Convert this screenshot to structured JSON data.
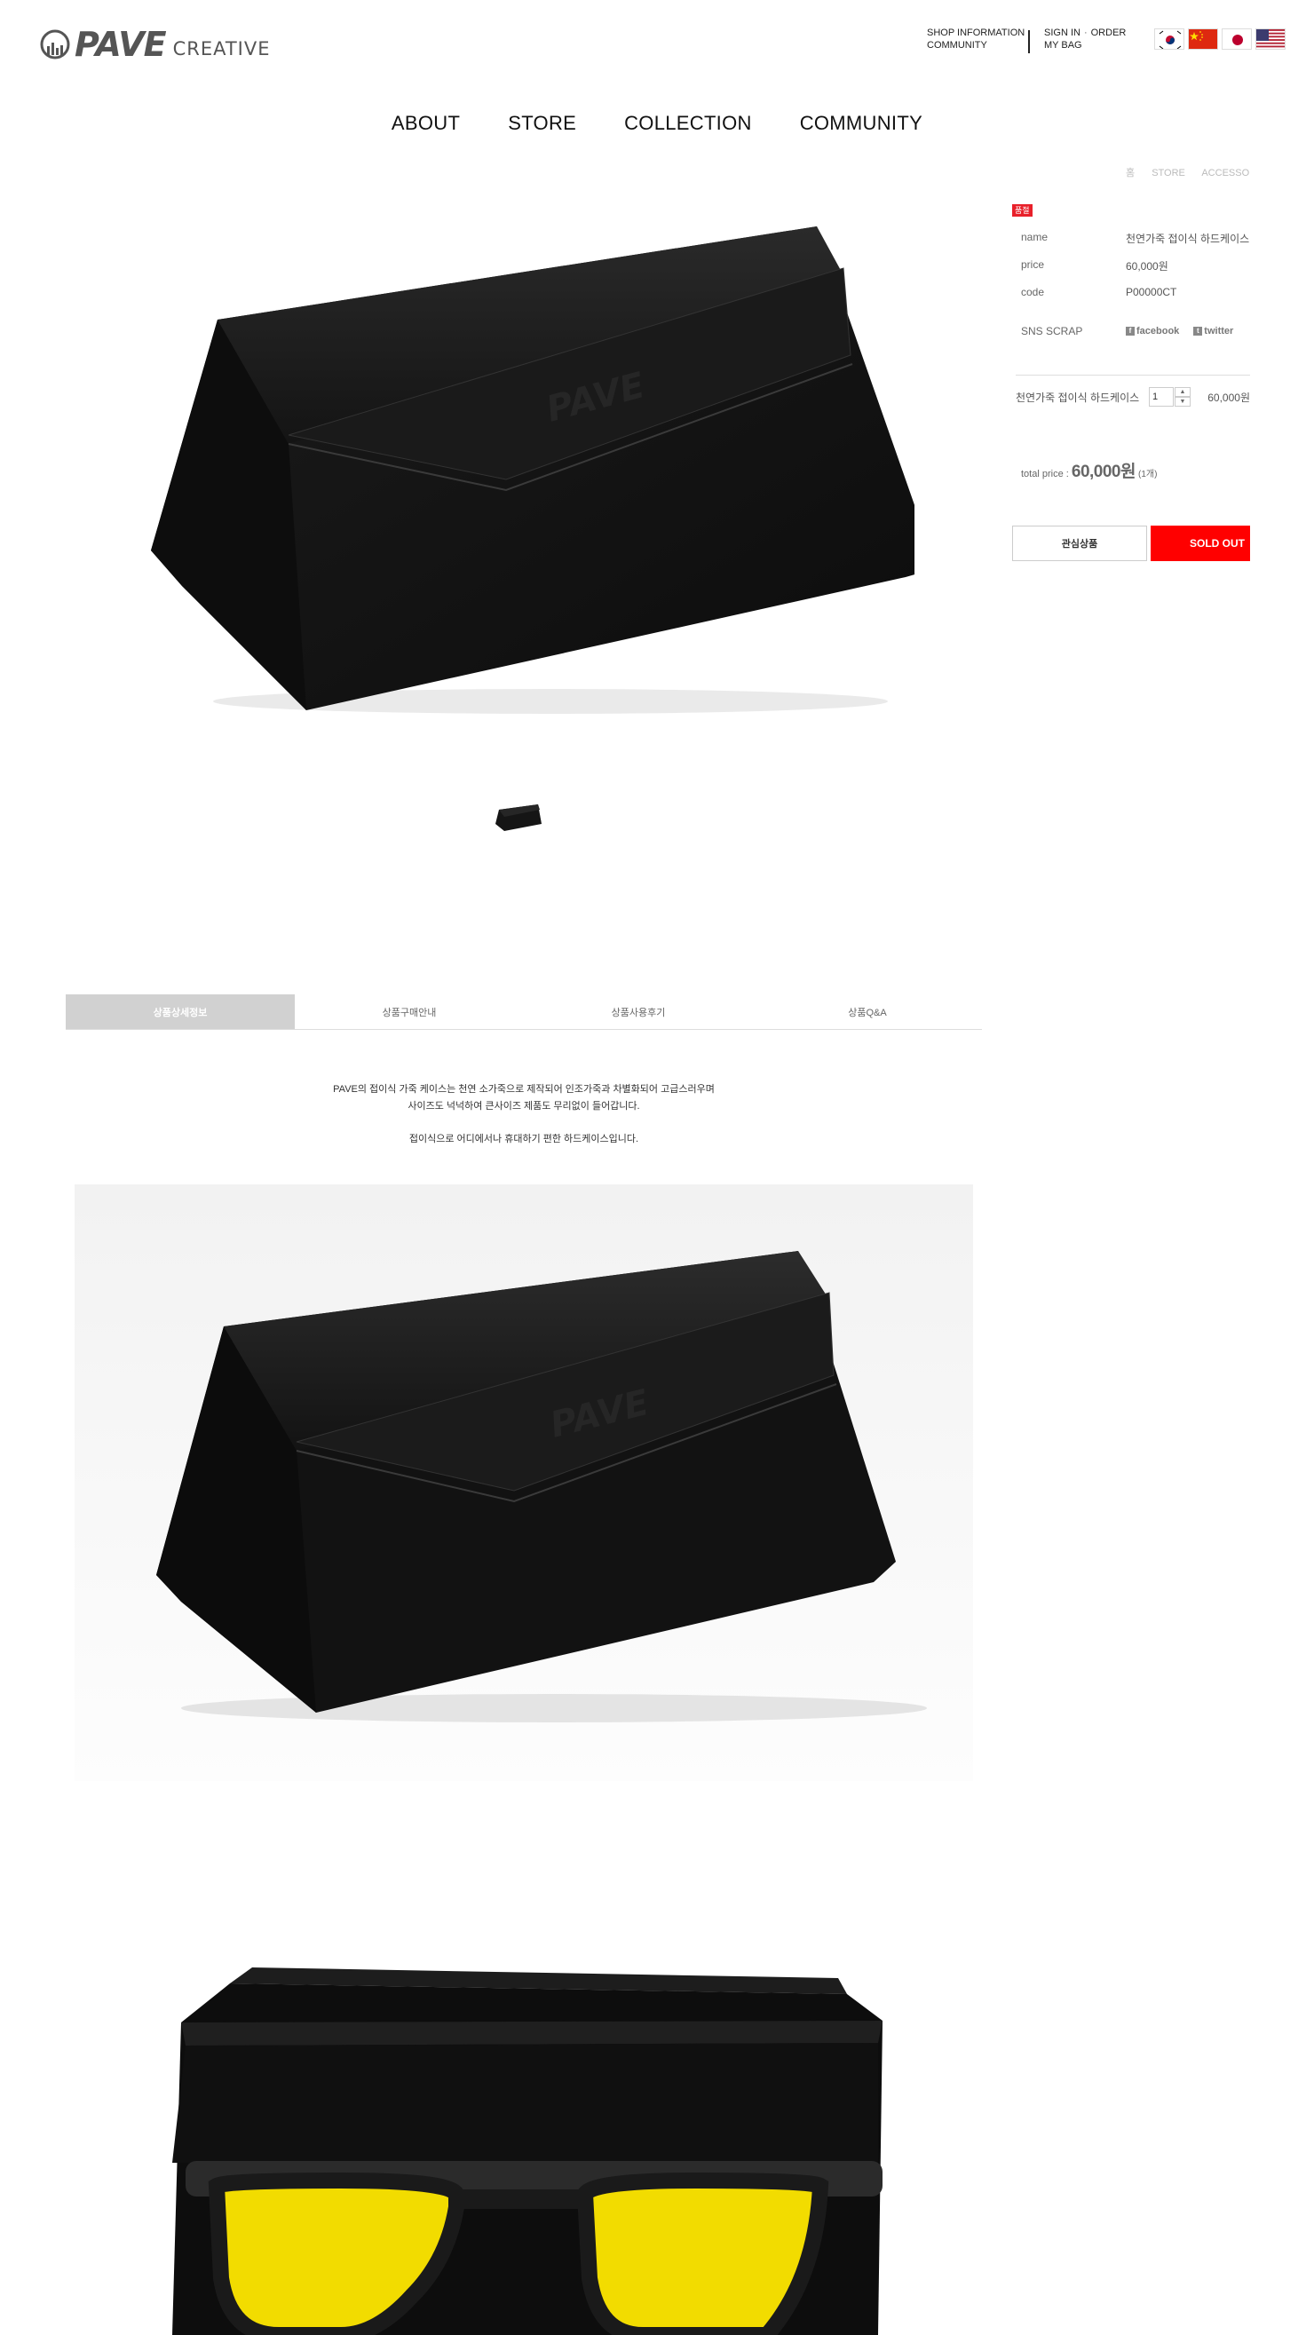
{
  "header": {
    "logo": {
      "brand": "PAVE",
      "sub": "CREATIVE",
      "mark_icon": "pave-circle-icon"
    },
    "util_links": {
      "shop_information": "SHOP INFORMATION",
      "community": "COMMUNITY",
      "sign_in": "SIGN IN",
      "separator": "·",
      "order": "ORDER",
      "my_bag": "MY BAG"
    },
    "flags": [
      "korea-flag-icon",
      "china-flag-icon",
      "japan-flag-icon",
      "usa-flag-icon"
    ]
  },
  "nav": {
    "items": [
      "ABOUT",
      "STORE",
      "COLLECTION",
      "COMMUNITY"
    ]
  },
  "breadcrumb": [
    "홈",
    "STORE",
    "ACCESSORY"
  ],
  "product": {
    "badge": "품절",
    "fields": [
      {
        "label": "name",
        "value": "천연가죽 접이식 하드케이스"
      },
      {
        "label": "price",
        "value": "60,000원"
      },
      {
        "label": "code",
        "value": "P00000CT"
      }
    ],
    "sns": {
      "label": "SNS SCRAP",
      "facebook": "facebook",
      "twitter": "twitter"
    },
    "option": {
      "name": "천연가죽 접이식 하드케이스",
      "qty": "1",
      "price": "60,000원"
    },
    "total": {
      "label": "total price :",
      "price": "60,000원",
      "count": "(1개)"
    },
    "buttons": {
      "wishlist": "관심상품",
      "soldout": "SOLD OUT"
    }
  },
  "tabs": [
    "상품상세정보",
    "상품구매안내",
    "상품사용후기",
    "상품Q&A"
  ],
  "description": {
    "line1": "PAVE의 접이식 가죽 케이스는 천연 소가죽으로 제작되어 인조가죽과 차별화되어 고급스러우며",
    "line2": "사이즈도 넉넉하여 큰사이즈 제품도 무리없이 들어갑니다.",
    "line3": "접이식으로 어디에서나 휴대하기 편한 하드케이스입니다."
  },
  "colors": {
    "accent_red": "#ff0000",
    "badge_red": "#e8202a",
    "tab_active_bg": "#d1d1d1",
    "text_dark": "#333333",
    "case_black": "#141414",
    "lens_yellow": "#f2dc00"
  }
}
